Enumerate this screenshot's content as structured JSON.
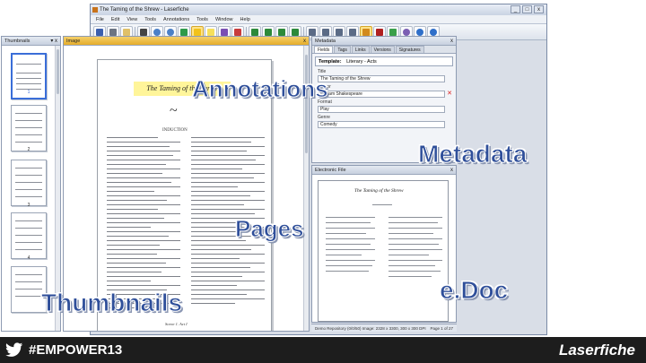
{
  "window": {
    "title": "The Taming of the Shrew - Laserfiche",
    "controls": [
      "_",
      "□",
      "x"
    ]
  },
  "menu": [
    "File",
    "Edit",
    "View",
    "Tools",
    "Annotations",
    "Tools",
    "Window",
    "Help"
  ],
  "panels": {
    "thumbnails": {
      "title": "Thumbnails",
      "close": "▾ x",
      "page_numbers": [
        "1",
        "2",
        "3",
        "4"
      ]
    },
    "image": {
      "title": "Image",
      "close": "x"
    },
    "metadata": {
      "title": "Metadata",
      "close": "x"
    },
    "edoc": {
      "title": "Electronic File",
      "close": "x"
    }
  },
  "document": {
    "play_title": "The Taming of the Shrew",
    "section": "INDUCTION",
    "footer": "Scene 1. Act I"
  },
  "metadata": {
    "tabs": [
      "Fields",
      "Tags",
      "Links",
      "Versions",
      "Signatures"
    ],
    "template_label": "Template:",
    "template_value": "Literary - Acts",
    "fields": [
      {
        "label": "Title",
        "value": "The Taming of the Shrew"
      },
      {
        "label": "Author",
        "value": "William Shakespeare"
      },
      {
        "label": "Format",
        "value": "Play"
      },
      {
        "label": "Genre",
        "value": "Comedy"
      }
    ]
  },
  "edoc": {
    "page_title": "The Taming of the Shrew"
  },
  "status": {
    "left": "Demo Repository (0/0/50)",
    "image_info": "Image: 2328 x 3300, 300 x 300 DPI",
    "page": "Page 1 of 27"
  },
  "callouts": {
    "annotations": "Annotations",
    "metadata": "Metadata",
    "pages": "Pages",
    "edoc": "e.Doc",
    "thumbnails": "Thumbnails"
  },
  "footer": {
    "hashtag": "#EMPOWER13",
    "brand": "Laserfiche"
  },
  "colors": {
    "accent": "#2f4f9a",
    "highlight": "#fff59a",
    "footer_bg": "#1d1d1d"
  }
}
